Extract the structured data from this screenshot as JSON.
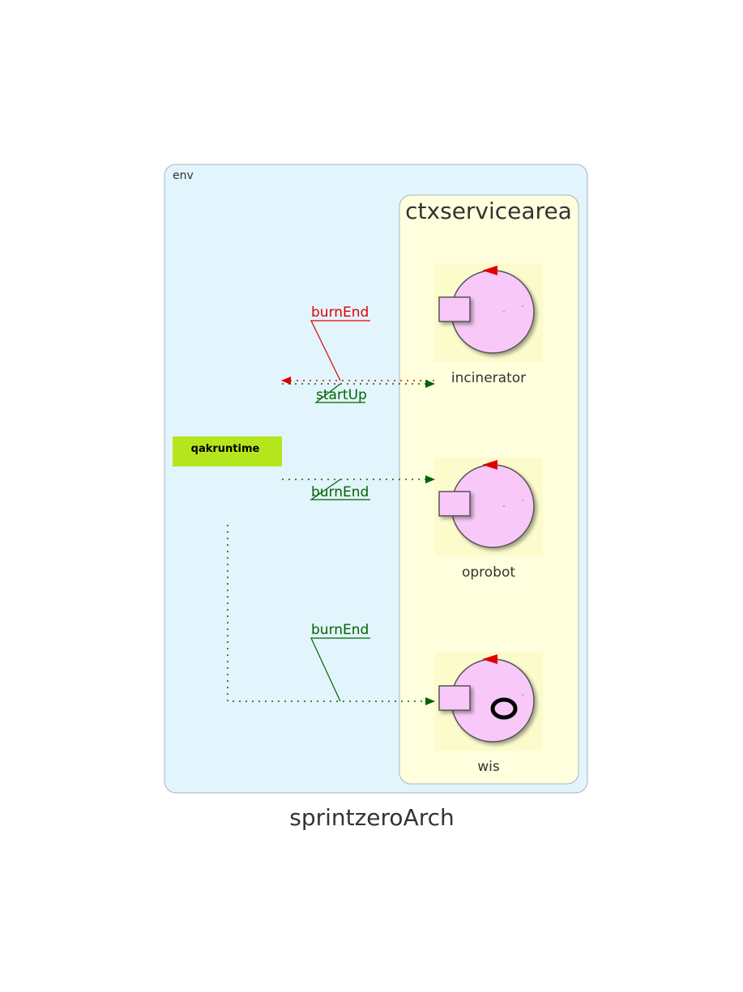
{
  "diagram_title": "sprintzeroArch",
  "env": {
    "label": "env"
  },
  "context": {
    "label": "ctxservicearea"
  },
  "runtime": {
    "label": "qakruntime",
    "color": "#b5e61d"
  },
  "actors": {
    "incinerator": {
      "label": "incinerator"
    },
    "oprobot": {
      "label": "oprobot"
    },
    "wis": {
      "label": "wis"
    }
  },
  "edges": {
    "incinerator_to_runtime": {
      "label": "burnEnd",
      "color": "#e00000"
    },
    "runtime_to_incinerator": {
      "label": "startUp",
      "color": "#006400"
    },
    "runtime_to_oprobot": {
      "label": "burnEnd",
      "color": "#006400"
    },
    "runtime_to_wis": {
      "label": "burnEnd",
      "color": "#006400"
    }
  },
  "colors": {
    "env_fill": "#e2f4fc",
    "context_fill": "#ffffde",
    "actor_fill": "#f8c8f8",
    "actor_arrowhead": "#e00000"
  }
}
